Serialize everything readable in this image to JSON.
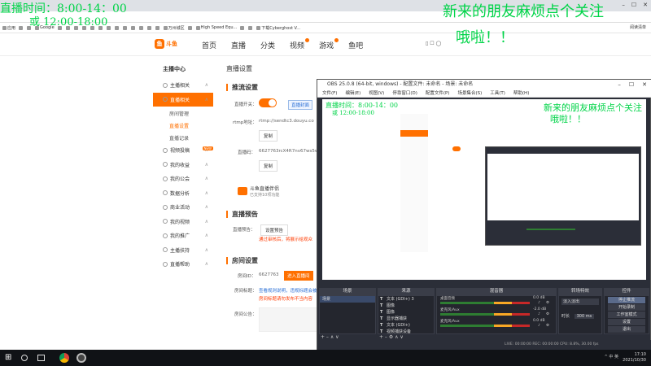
{
  "overlay": {
    "stream_time_line1": "直播时间：8:00-14：00",
    "stream_time_line2": "或 12:00-18:00",
    "welcome_line1": "新来的朋友麻烦点个关注",
    "welcome_line2": "哦啦！！"
  },
  "bookmarks": [
    "应用",
    "",
    "",
    "Google",
    "",
    "",
    "",
    "",
    "",
    "",
    "",
    "",
    "",
    "",
    "",
    "",
    "",
    "万州城区",
    "",
    "High Speed Equ...",
    "",
    "",
    "下载Cyberghost V...",
    "阅读清单"
  ],
  "bookmarks_right": "阅读清单",
  "site": {
    "logo_text": "斗鱼",
    "logo_sub": "douyu.com",
    "nav": [
      "首页",
      "直播",
      "分类",
      "视频",
      "游戏",
      "鱼吧"
    ]
  },
  "sidebar": {
    "title": "主播中心",
    "items": [
      {
        "label": "主播相关",
        "type": "item"
      },
      {
        "label": "直播相关",
        "type": "active"
      },
      {
        "label": "房间管理",
        "type": "sub"
      },
      {
        "label": "直播设置",
        "type": "sub-selected"
      },
      {
        "label": "直播记录",
        "type": "sub"
      },
      {
        "label": "视频投稿",
        "type": "item",
        "tag": "NEW"
      },
      {
        "label": "我的收益",
        "type": "item"
      },
      {
        "label": "我的公会",
        "type": "item"
      },
      {
        "label": "数据分析",
        "type": "item"
      },
      {
        "label": "商业活动",
        "type": "item"
      },
      {
        "label": "我的视频",
        "type": "item"
      },
      {
        "label": "我的推广",
        "type": "item"
      },
      {
        "label": "主播扶持",
        "type": "item"
      },
      {
        "label": "直播帮助",
        "type": "item"
      }
    ]
  },
  "main": {
    "page_title": "直播设置",
    "section_push": "推流设置",
    "live_switch_label": "直播开关：",
    "live_switch_link": "直播封面",
    "rtmp_label": "rtmp地址：",
    "rtmp_value": "rtmp://sendtc3.douyu.co",
    "copy_btn": "复制",
    "code_label": "直播码：",
    "code_value": "6627763rcX4R7nv67ws5w",
    "copy_btn2": "复制",
    "promo_title": "斗鱼直播伴侣",
    "promo_sub": "已支持10项功能",
    "section_forecast": "直播预告",
    "forecast_label": "直播预告：",
    "forecast_btn": "设置预告",
    "forecast_warn": "通过审核后，将展示给观众",
    "section_room": "房间设置",
    "room_id_label": "房间ID：",
    "room_id_value": "6627763",
    "room_btn": "进入直播间",
    "room_title_label": "房间标题：",
    "room_title_link": "查看规则说明，违规标题会被删除",
    "room_title_warn": "房间标题请勿发布不当内容",
    "announce_label": "房间公告："
  },
  "obs": {
    "title": "OBS 25.0.8 (64-bit, windows) - 配置文件: 未命名 - 场景: 未命名",
    "menu": [
      "文件(F)",
      "编辑(E)",
      "视图(V)",
      "停靠窗口(D)",
      "配置文件(P)",
      "场景集合(S)",
      "工具(T)",
      "帮助(H)"
    ],
    "docks": {
      "scenes": "场景",
      "sources": "来源",
      "mixer": "混音器",
      "transitions": "转场特效",
      "controls": "控件"
    },
    "scene_item": "场景",
    "sources": [
      "文本 (GDI+) 3",
      "图像",
      "图像",
      "显示器捕获",
      "文本 (GDI+)",
      "视频捕获设备"
    ],
    "mixer": [
      {
        "name": "桌面音频",
        "db": "0.0 dB"
      },
      {
        "name": "麦克风/Aux",
        "db": "-2.0 dB"
      },
      {
        "name": "麦克风/Aux",
        "db": "0.0 dB"
      }
    ],
    "transition_name": "淡入淡出",
    "duration_label": "时长",
    "duration_value": "300 ms",
    "controls": [
      "停止推流",
      "开始录制",
      "工作室模式",
      "设置",
      "退出"
    ],
    "status": "LIVE: 00:00:00   REC: 00:00:00   CPU: 8.8%, 30.00 fps"
  },
  "taskbar": {
    "time": "17:10",
    "date": "2021/10/30",
    "tray": "^  中  英"
  }
}
